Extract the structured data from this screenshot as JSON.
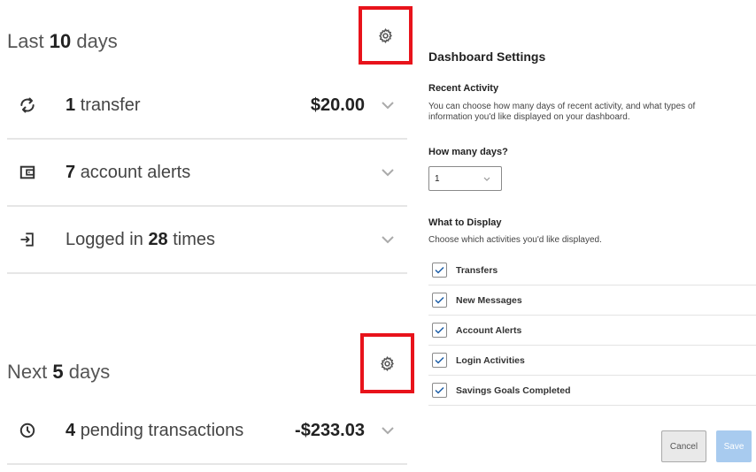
{
  "last": {
    "prefix": "Last",
    "count": "10",
    "suffix": "days",
    "rows": [
      {
        "icon": "transfer-icon",
        "count": "1",
        "label": "transfer",
        "amount": "$20.00"
      },
      {
        "icon": "wallet-icon",
        "count": "7",
        "label": "account alerts",
        "amount": ""
      },
      {
        "icon": "login-icon",
        "pre": "Logged in",
        "count": "28",
        "label": "times",
        "amount": ""
      }
    ]
  },
  "next": {
    "prefix": "Next",
    "count": "5",
    "suffix": "days",
    "rows": [
      {
        "icon": "clock-icon",
        "count": "4",
        "label": "pending transactions",
        "amount": "-$233.03"
      }
    ]
  },
  "settings": {
    "title": "Dashboard Settings",
    "recent_heading": "Recent Activity",
    "recent_desc": "You can choose how many days of recent activity, and what types of information you'd like displayed on your dashboard.",
    "days_heading": "How many days?",
    "days_value": "1",
    "display_heading": "What to Display",
    "display_desc": "Choose which activities you'd like displayed.",
    "options": [
      {
        "label": "Transfers",
        "checked": true
      },
      {
        "label": "New Messages",
        "checked": true
      },
      {
        "label": "Account Alerts",
        "checked": true
      },
      {
        "label": "Login Activities",
        "checked": true
      },
      {
        "label": "Savings Goals Completed",
        "checked": true
      }
    ],
    "cancel_label": "Cancel",
    "save_label": "Save"
  },
  "colors": {
    "highlight": "#e8131b",
    "save": "#a8cbef",
    "checkmark": "#1f5fa8"
  }
}
